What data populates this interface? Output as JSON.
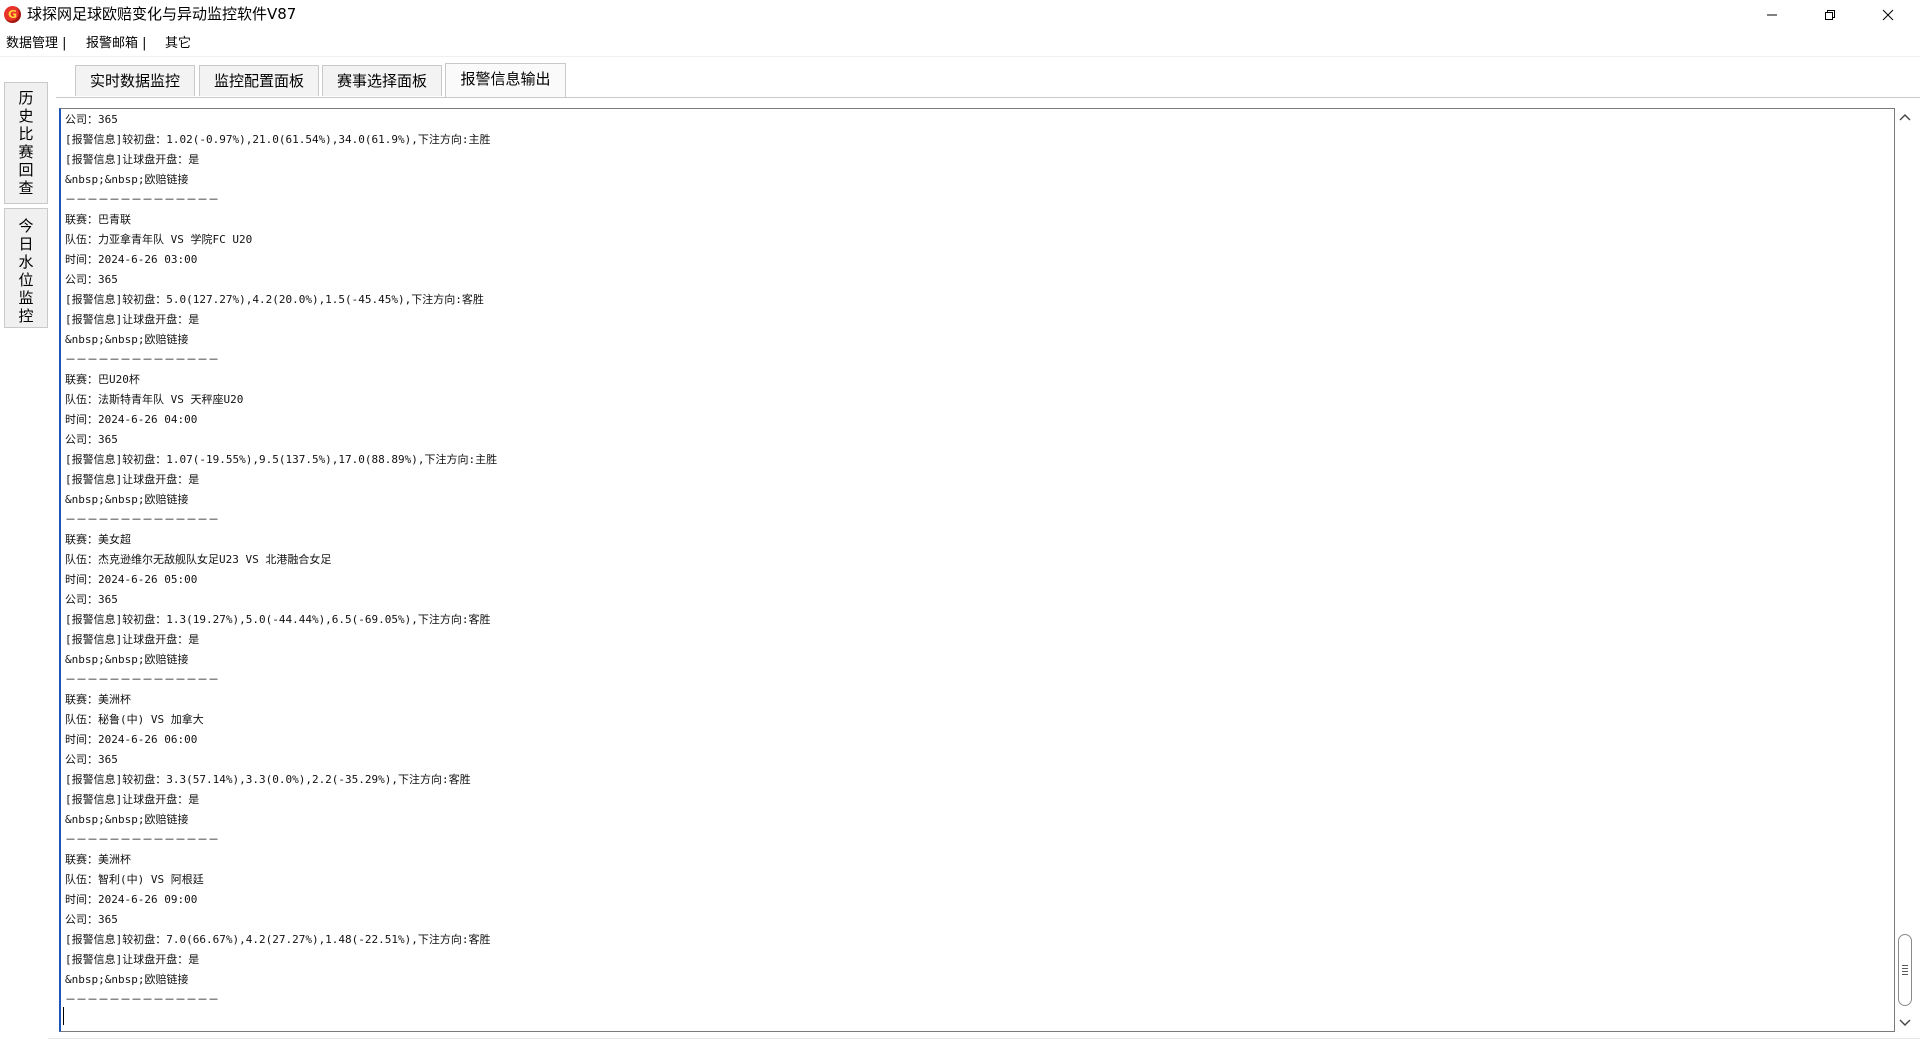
{
  "window": {
    "title": "球探网足球欧赔变化与异动监控软件V87",
    "app_icon_glyph": "G"
  },
  "menu": {
    "items": [
      "数据管理 |",
      "报警邮箱 |",
      "其它"
    ]
  },
  "sidebar": {
    "tabs": [
      {
        "label": "历史比赛回查"
      },
      {
        "label": "今日水位监控"
      }
    ]
  },
  "tabs": [
    {
      "label": "实时数据监控"
    },
    {
      "label": "监控配置面板"
    },
    {
      "label": "赛事选择面板"
    },
    {
      "label": "报警信息输出"
    }
  ],
  "active_tab": "报警信息输出",
  "output": {
    "lines": [
      "公司：365",
      "[报警信息]较初盘：1.02(-0.97%),21.0(61.54%),34.0(61.9%),下注方向:主胜",
      "[报警信息]让球盘开盘：是",
      "&nbsp;&nbsp;欧赔链接",
      "－－－－－－－－－－－－－－",
      "联赛：巴青联",
      "队伍：力亚拿青年队 VS 学院FC U20",
      "时间：2024-6-26 03:00",
      "公司：365",
      "[报警信息]较初盘：5.0(127.27%),4.2(20.0%),1.5(-45.45%),下注方向:客胜",
      "[报警信息]让球盘开盘：是",
      "&nbsp;&nbsp;欧赔链接",
      "－－－－－－－－－－－－－－",
      "联赛：巴U20杯",
      "队伍：法斯特青年队 VS 天秤座U20",
      "时间：2024-6-26 04:00",
      "公司：365",
      "[报警信息]较初盘：1.07(-19.55%),9.5(137.5%),17.0(88.89%),下注方向:主胜",
      "[报警信息]让球盘开盘：是",
      "&nbsp;&nbsp;欧赔链接",
      "－－－－－－－－－－－－－－",
      "联赛：美女超",
      "队伍：杰克逊维尔无敌舰队女足U23 VS 北港融合女足",
      "时间：2024-6-26 05:00",
      "公司：365",
      "[报警信息]较初盘：1.3(19.27%),5.0(-44.44%),6.5(-69.05%),下注方向:客胜",
      "[报警信息]让球盘开盘：是",
      "&nbsp;&nbsp;欧赔链接",
      "－－－－－－－－－－－－－－",
      "联赛：美洲杯",
      "队伍：秘鲁(中) VS 加拿大",
      "时间：2024-6-26 06:00",
      "公司：365",
      "[报警信息]较初盘：3.3(57.14%),3.3(0.0%),2.2(-35.29%),下注方向:客胜",
      "[报警信息]让球盘开盘：是",
      "&nbsp;&nbsp;欧赔链接",
      "－－－－－－－－－－－－－－",
      "联赛：美洲杯",
      "队伍：智利(中) VS 阿根廷",
      "时间：2024-6-26 09:00",
      "公司：365",
      "[报警信息]较初盘：7.0(66.67%),4.2(27.27%),1.48(-22.51%),下注方向:客胜",
      "[报警信息]让球盘开盘：是",
      "&nbsp;&nbsp;欧赔链接",
      "－－－－－－－－－－－－－－"
    ]
  },
  "scrollbar": {
    "position_fraction": 1.0
  },
  "icons": {
    "minimize": "minimize-icon",
    "maximize": "restore-icon",
    "close": "close-icon",
    "scroll_up": "chevron-up-icon",
    "scroll_down": "chevron-down-icon"
  },
  "colors": {
    "accent_border": "#1e56b8",
    "tab_bg": "#f3f3f3",
    "app_icon_red": "#e8332a"
  }
}
